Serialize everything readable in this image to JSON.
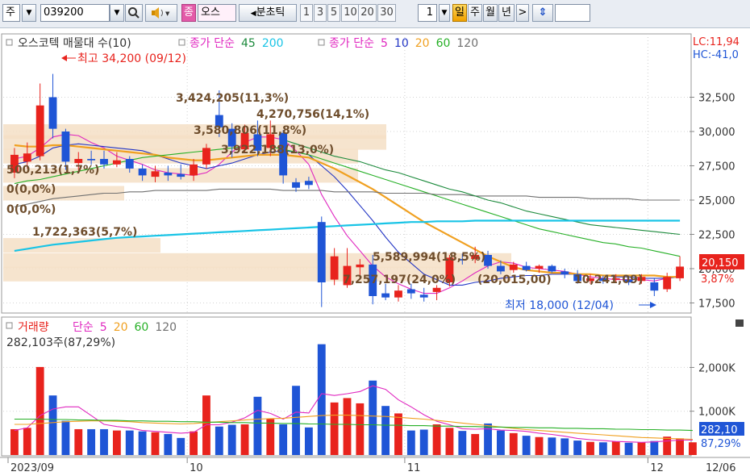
{
  "toolbar": {
    "market": "주",
    "code": "039200",
    "name": "오스",
    "period_label": "분초틱",
    "periods": [
      "1",
      "3",
      "5",
      "10",
      "20",
      "30"
    ],
    "count": "1",
    "day": "일",
    "week": "주",
    "month": "월",
    "year": "년",
    "next": ">",
    "updown": "⇕",
    "search_icon": "search-icon",
    "sound_icon": "speaker-icon",
    "tag_label": "종"
  },
  "legend": {
    "title": "오스코텍 매물대 수(10)",
    "ma_a_label": "종가 단순",
    "ma_a": [
      "45",
      "200"
    ],
    "ma_b_label": "종가 단순",
    "ma_b": [
      "5",
      "10",
      "20",
      "60",
      "120"
    ]
  },
  "right_header": {
    "lc": "LC:11,94",
    "hc": "HC:-41,0"
  },
  "current": {
    "price": "20,150",
    "pct": "3,87%"
  },
  "annotations": {
    "high": "최고 34,200 (09/12)",
    "low": "최저 18,000 (12/04)"
  },
  "volume_profile": [
    {
      "price": 30000,
      "text": "3,424,205(11,3%)"
    },
    {
      "price": 29200,
      "text": "4,270,756(14,1%)"
    },
    {
      "price": 28200,
      "text": "3,580,806(11,8%)"
    },
    {
      "price": 26800,
      "text": "3,922,188(13,0%)"
    },
    {
      "price": 25500,
      "text": "500,213(1,7%)"
    },
    {
      "price": 24200,
      "text": "0(0,0%)"
    },
    {
      "price": 22800,
      "text": "0(0,0%)"
    },
    {
      "price": 21700,
      "text": "1,722,363(5,7%)"
    },
    {
      "price": 20600,
      "text": "5,589,994(18,5%)"
    },
    {
      "price": 19600,
      "text": "7,257,197(24,0%)"
    },
    {
      "price": 19550,
      "text": "(20,015,00)"
    },
    {
      "price": 19500,
      "text": "10,241,09)"
    }
  ],
  "volume_legend": {
    "title": "거래량",
    "ma_label": "단순",
    "ma": [
      "5",
      "20",
      "60",
      "120"
    ],
    "info": "282,103주(87,29%)"
  },
  "volume_current": {
    "value": "282,10",
    "pct": "87,29%"
  },
  "bottom_right": "12/06",
  "colors": {
    "up": "#e8231d",
    "down": "#1f55d6",
    "ma5": "#e028c0",
    "ma10": "#2235c4",
    "ma20": "#f0a020",
    "ma60": "#27b027",
    "ma120": "#707070",
    "ma45": "#1c8a3c",
    "ma200": "#19c4e6",
    "profile": "#f5dfc6",
    "profile_text": "#6e4d2c"
  },
  "chart_data": {
    "type": "candlestick",
    "price_axis": {
      "ticks": [
        32500,
        30000,
        27500,
        25000,
        22500,
        20000,
        17500
      ],
      "tick_labels": [
        "32,500",
        "30,000",
        "27,500",
        "25,000",
        "22,500",
        "20,000",
        "17,500"
      ],
      "ylim": [
        17000,
        35000
      ]
    },
    "volume_axis": {
      "ticks": [
        2000,
        1000
      ],
      "tick_labels": [
        "2,000K",
        "1,000K"
      ],
      "ylim": [
        0,
        2800
      ]
    },
    "x_labels": [
      {
        "index": 0,
        "text": "2023/09"
      },
      {
        "index": 14,
        "text": "10"
      },
      {
        "index": 31,
        "text": "11"
      },
      {
        "index": 50,
        "text": "12"
      }
    ],
    "candles": [
      {
        "o": 27000,
        "h": 28800,
        "l": 26600,
        "c": 28300
      },
      {
        "o": 27800,
        "h": 29200,
        "l": 27300,
        "c": 28400
      },
      {
        "o": 28200,
        "h": 33500,
        "l": 27900,
        "c": 31900
      },
      {
        "o": 32500,
        "h": 34200,
        "l": 29500,
        "c": 30200
      },
      {
        "o": 30000,
        "h": 30200,
        "l": 27200,
        "c": 27800
      },
      {
        "o": 27700,
        "h": 28500,
        "l": 27200,
        "c": 28000
      },
      {
        "o": 28000,
        "h": 28600,
        "l": 27600,
        "c": 27900
      },
      {
        "o": 28000,
        "h": 28600,
        "l": 27300,
        "c": 27600
      },
      {
        "o": 27600,
        "h": 28500,
        "l": 27400,
        "c": 27900
      },
      {
        "o": 28000,
        "h": 28200,
        "l": 27000,
        "c": 27300
      },
      {
        "o": 27300,
        "h": 27600,
        "l": 26400,
        "c": 26800
      },
      {
        "o": 26700,
        "h": 27500,
        "l": 26300,
        "c": 27100
      },
      {
        "o": 27000,
        "h": 27500,
        "l": 26400,
        "c": 26800
      },
      {
        "o": 26900,
        "h": 27600,
        "l": 26500,
        "c": 26700
      },
      {
        "o": 26800,
        "h": 28000,
        "l": 26400,
        "c": 27600
      },
      {
        "o": 27600,
        "h": 29100,
        "l": 27300,
        "c": 28800
      },
      {
        "o": 31200,
        "h": 33000,
        "l": 29600,
        "c": 30300
      },
      {
        "o": 30200,
        "h": 30600,
        "l": 28100,
        "c": 28900
      },
      {
        "o": 28700,
        "h": 30500,
        "l": 28500,
        "c": 29900
      },
      {
        "o": 29800,
        "h": 30800,
        "l": 28200,
        "c": 28600
      },
      {
        "o": 28800,
        "h": 30800,
        "l": 28200,
        "c": 29800
      },
      {
        "o": 29900,
        "h": 30100,
        "l": 26200,
        "c": 26800
      },
      {
        "o": 26300,
        "h": 26600,
        "l": 25600,
        "c": 25900
      },
      {
        "o": 26400,
        "h": 26700,
        "l": 25800,
        "c": 26100
      },
      {
        "o": 23400,
        "h": 23800,
        "l": 17200,
        "c": 19000
      },
      {
        "o": 19200,
        "h": 21500,
        "l": 18800,
        "c": 20900
      },
      {
        "o": 18800,
        "h": 21500,
        "l": 18600,
        "c": 20200
      },
      {
        "o": 20100,
        "h": 20700,
        "l": 19200,
        "c": 20300
      },
      {
        "o": 20300,
        "h": 21000,
        "l": 17400,
        "c": 18000
      },
      {
        "o": 18200,
        "h": 18900,
        "l": 17700,
        "c": 17900
      },
      {
        "o": 17900,
        "h": 18800,
        "l": 17600,
        "c": 18400
      },
      {
        "o": 18500,
        "h": 18900,
        "l": 17800,
        "c": 18200
      },
      {
        "o": 18100,
        "h": 18600,
        "l": 17600,
        "c": 17900
      },
      {
        "o": 18300,
        "h": 18800,
        "l": 17700,
        "c": 18600
      },
      {
        "o": 19000,
        "h": 21000,
        "l": 18700,
        "c": 20800
      },
      {
        "o": 20700,
        "h": 21100,
        "l": 20300,
        "c": 20600
      },
      {
        "o": 20700,
        "h": 21600,
        "l": 20400,
        "c": 21000
      },
      {
        "o": 21000,
        "h": 21300,
        "l": 20000,
        "c": 20200
      },
      {
        "o": 20200,
        "h": 20600,
        "l": 19600,
        "c": 19800
      },
      {
        "o": 19900,
        "h": 20500,
        "l": 19700,
        "c": 20300
      },
      {
        "o": 20200,
        "h": 20500,
        "l": 19800,
        "c": 19900
      },
      {
        "o": 20000,
        "h": 20300,
        "l": 19700,
        "c": 20200
      },
      {
        "o": 20200,
        "h": 20300,
        "l": 19700,
        "c": 19800
      },
      {
        "o": 19800,
        "h": 20000,
        "l": 19300,
        "c": 19600
      },
      {
        "o": 19600,
        "h": 19900,
        "l": 18900,
        "c": 19100
      },
      {
        "o": 19100,
        "h": 19600,
        "l": 18900,
        "c": 19300
      },
      {
        "o": 19300,
        "h": 19500,
        "l": 18900,
        "c": 19100
      },
      {
        "o": 19200,
        "h": 19600,
        "l": 19000,
        "c": 19300
      },
      {
        "o": 19200,
        "h": 19500,
        "l": 18800,
        "c": 19000
      },
      {
        "o": 19100,
        "h": 19600,
        "l": 18900,
        "c": 19400
      },
      {
        "o": 19000,
        "h": 19300,
        "l": 18000,
        "c": 18400
      },
      {
        "o": 18500,
        "h": 19700,
        "l": 18300,
        "c": 19400
      },
      {
        "o": 19300,
        "h": 20900,
        "l": 19100,
        "c": 20150
      }
    ],
    "volume_k": [
      590,
      620,
      2010,
      1360,
      780,
      590,
      590,
      590,
      560,
      560,
      540,
      520,
      480,
      390,
      540,
      1360,
      650,
      690,
      700,
      1330,
      820,
      700,
      1580,
      630,
      2530,
      1200,
      1300,
      1180,
      1700,
      1120,
      950,
      560,
      580,
      700,
      620,
      550,
      480,
      720,
      560,
      500,
      440,
      410,
      400,
      380,
      330,
      300,
      290,
      310,
      280,
      290,
      320,
      420,
      380,
      290
    ],
    "ma_series": [
      {
        "name": "5",
        "color": "#e028c0",
        "values": [
          28000,
          28200,
          28800,
          29600,
          29800,
          29700,
          29200,
          28800,
          28200,
          27900,
          27600,
          27200,
          27000,
          26900,
          26800,
          27000,
          27600,
          28500,
          29200,
          29600,
          29600,
          29400,
          28600,
          27600,
          25400,
          23800,
          22400,
          21300,
          20200,
          19400,
          18900,
          18500,
          18200,
          18200,
          18600,
          19100,
          19700,
          20200,
          20500,
          20400,
          20100,
          20000,
          19900,
          19800,
          19600,
          19400,
          19300,
          19200,
          19200,
          19200,
          19100,
          19300,
          19500
        ]
      },
      {
        "name": "10",
        "color": "#2235c4",
        "values": [
          27600,
          27800,
          28200,
          28800,
          29000,
          29100,
          29000,
          28900,
          28800,
          28700,
          28600,
          28300,
          28000,
          27700,
          27500,
          27300,
          27500,
          27700,
          28000,
          28300,
          28500,
          28600,
          28500,
          28300,
          27500,
          26700,
          25700,
          24600,
          23500,
          22300,
          21200,
          20400,
          19600,
          19200,
          18800,
          18800,
          19000,
          19100,
          19300,
          19400,
          19500,
          19500,
          19600,
          19600,
          19600,
          19600,
          19500,
          19400,
          19400,
          19300,
          19300,
          19300,
          19400
        ]
      },
      {
        "name": "20",
        "color": "#f0a020",
        "values": [
          29000,
          28900,
          28900,
          29000,
          29000,
          28900,
          28800,
          28700,
          28600,
          28500,
          28400,
          28300,
          28100,
          28000,
          27900,
          27900,
          28000,
          28100,
          28200,
          28300,
          28300,
          28300,
          28200,
          28100,
          27700,
          27300,
          26800,
          26300,
          25800,
          25200,
          24600,
          24000,
          23400,
          22900,
          22400,
          21900,
          21400,
          20900,
          20500,
          20100,
          19900,
          19800,
          19700,
          19700,
          19600,
          19600,
          19500,
          19500,
          19500,
          19500,
          19500,
          19400,
          19400
        ]
      },
      {
        "name": "60",
        "color": "#27b027",
        "values": [
          26200,
          26400,
          26500,
          26700,
          26900,
          27100,
          27300,
          27500,
          27700,
          27900,
          28100,
          28200,
          28300,
          28400,
          28500,
          28600,
          28700,
          28800,
          28900,
          29000,
          28900,
          28700,
          28500,
          28300,
          28000,
          27700,
          27400,
          27100,
          26800,
          26500,
          26200,
          25900,
          25600,
          25300,
          25000,
          24700,
          24400,
          24100,
          23800,
          23500,
          23200,
          22900,
          22700,
          22500,
          22300,
          22100,
          21900,
          21800,
          21600,
          21500,
          21300,
          21100,
          20900
        ]
      },
      {
        "name": "120",
        "color": "#707070",
        "values": [
          24500,
          24700,
          24900,
          25100,
          25200,
          25300,
          25400,
          25500,
          25500,
          25600,
          25600,
          25700,
          25700,
          25700,
          25700,
          25700,
          25800,
          25800,
          25800,
          25800,
          25800,
          25700,
          25700,
          25700,
          25700,
          25600,
          25600,
          25600,
          25600,
          25500,
          25500,
          25500,
          25500,
          25400,
          25400,
          25400,
          25300,
          25300,
          25300,
          25300,
          25300,
          25200,
          25200,
          25200,
          25200,
          25100,
          25100,
          25100,
          25100,
          25000,
          25000,
          25000,
          25000
        ]
      },
      {
        "name": "45",
        "color": "#1c8a3c",
        "values": [
          null,
          null,
          null,
          null,
          null,
          null,
          null,
          null,
          null,
          null,
          null,
          null,
          null,
          null,
          null,
          null,
          null,
          null,
          null,
          null,
          null,
          29400,
          29100,
          28800,
          28500,
          28200,
          28000,
          27800,
          27500,
          27200,
          27000,
          26700,
          26400,
          26100,
          25800,
          25600,
          25300,
          25000,
          24800,
          24500,
          24200,
          24000,
          23800,
          23600,
          23400,
          23200,
          23100,
          23000,
          22900,
          22800,
          22700,
          22600,
          22500
        ]
      },
      {
        "name": "200",
        "color": "#19c4e6",
        "values": [
          21300,
          21450,
          21600,
          21750,
          21850,
          21950,
          22050,
          22150,
          22250,
          22300,
          22350,
          22400,
          22450,
          22500,
          22550,
          22600,
          22650,
          22700,
          22750,
          22800,
          22850,
          22900,
          22950,
          23000,
          23050,
          23100,
          23150,
          23200,
          23250,
          23300,
          23350,
          23400,
          23400,
          23450,
          23450,
          23450,
          23500,
          23500,
          23500,
          23500,
          23500,
          23500,
          23500,
          23500,
          23500,
          23500,
          23500,
          23500,
          23500,
          23500,
          23500,
          23500,
          23500
        ]
      }
    ],
    "vol_ma": [
      {
        "name": "5",
        "color": "#e028c0",
        "values": [
          560,
          620,
          900,
          1050,
          1100,
          1100,
          900,
          700,
          650,
          620,
          560,
          540,
          520,
          500,
          520,
          690,
          690,
          750,
          850,
          1020,
          950,
          820,
          980,
          960,
          1400,
          1360,
          1400,
          1450,
          1580,
          1500,
          1260,
          1100,
          920,
          770,
          690,
          600,
          590,
          600,
          570,
          560,
          540,
          500,
          470,
          430,
          380,
          350,
          330,
          310,
          300,
          290,
          300,
          320,
          340,
          340
        ]
      },
      {
        "name": "20",
        "color": "#f0a020",
        "values": [
          700,
          700,
          720,
          740,
          760,
          770,
          780,
          780,
          770,
          760,
          740,
          730,
          720,
          710,
          720,
          740,
          760,
          780,
          800,
          820,
          830,
          840,
          860,
          880,
          900,
          910,
          910,
          900,
          890,
          880,
          860,
          840,
          820,
          790,
          760,
          730,
          700,
          670,
          640,
          610,
          580,
          560,
          540,
          520,
          500,
          480,
          460,
          440,
          420,
          400,
          390,
          380,
          370,
          360
        ]
      },
      {
        "name": "60",
        "color": "#27b027",
        "values": [
          820,
          820,
          820,
          810,
          810,
          800,
          800,
          790,
          790,
          780,
          780,
          770,
          770,
          760,
          760,
          750,
          750,
          740,
          740,
          730,
          730,
          720,
          720,
          710,
          710,
          700,
          700,
          690,
          690,
          680,
          680,
          670,
          670,
          660,
          660,
          650,
          650,
          640,
          640,
          630,
          630,
          620,
          620,
          610,
          610,
          600,
          600,
          590,
          590,
          580,
          580,
          570,
          570,
          560
        ]
      }
    ]
  }
}
